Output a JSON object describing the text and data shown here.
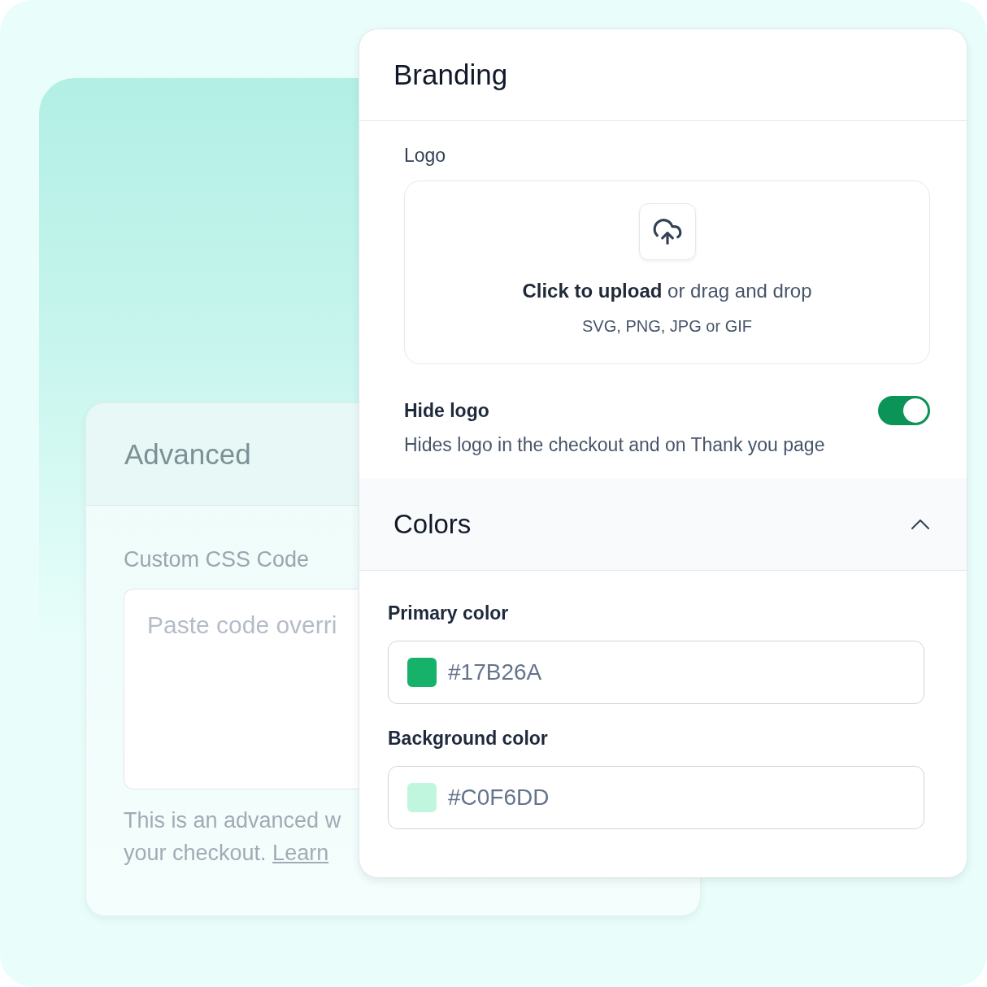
{
  "advanced": {
    "title": "Advanced",
    "css_field": {
      "label": "Custom CSS Code",
      "placeholder": "Paste code overri"
    },
    "help": {
      "text": "This is an advanced w your checkout.",
      "link": "Learn"
    }
  },
  "branding": {
    "title": "Branding",
    "logo": {
      "label": "Logo",
      "upload_text": "**Click to upload** or drag and drop",
      "formats": "SVG, PNG, JPG or GIF"
    },
    "hide_logo": {
      "label": "Hide logo",
      "description": "Hides logo in the checkout and on Thank you page",
      "on": true
    }
  },
  "colors": {
    "title": "Colors",
    "expanded": true,
    "fields": [
      {
        "label": "Primary color",
        "value": "#17B26A",
        "color": "#17b26a"
      },
      {
        "label": "Background color",
        "value": "#C0F6DD",
        "color": "#c0f6dd"
      }
    ]
  }
}
